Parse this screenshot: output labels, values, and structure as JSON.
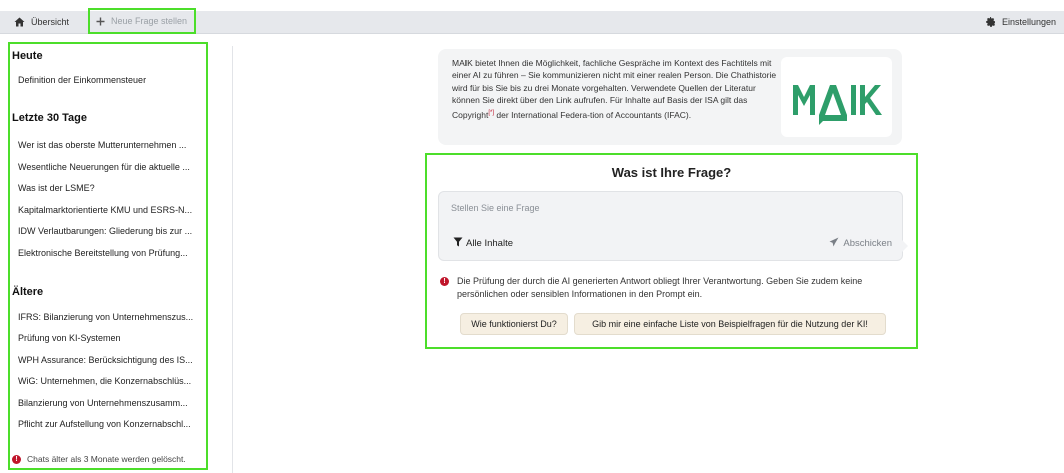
{
  "topbar": {
    "overview_label": "Übersicht",
    "overview_icon": "home-icon",
    "new_question_label": "Neue Frage stellen",
    "new_question_icon": "plus-icon",
    "settings_label": "Einstellungen",
    "settings_icon": "gear-icon"
  },
  "sidebar": {
    "sections": [
      {
        "heading": "Heute",
        "items": [
          "Definition der Einkommensteuer"
        ]
      },
      {
        "heading": "Letzte 30 Tage",
        "items": [
          "Wer ist das oberste Mutterunternehmen ...",
          "Wesentliche Neuerungen für die aktuelle ...",
          "Was ist der LSME?",
          "Kapitalmarktorientierte KMU und ESRS-N...",
          "IDW Verlautbarungen: Gliederung bis zur ...",
          "Elektronische Bereitstellung von Prüfung..."
        ]
      },
      {
        "heading": "Ältere",
        "items": [
          "IFRS: Bilanzierung von Unternehmenszus...",
          "Prüfung von KI-Systemen",
          "WPH Assurance: Berücksichtigung des IS...",
          "WiG: Unternehmen, die Konzernabschlüs...",
          "Bilanzierung von Unternehmenszusamm...",
          "Pflicht zur Aufstellung von Konzernabschl..."
        ]
      }
    ],
    "retention_note": "Chats älter als 3 Monate werden gelöscht."
  },
  "info": {
    "brand_prefix": "MA",
    "brand_highlight": "I",
    "brand_suffix": "K",
    "text_part1": " bietet Ihnen die Möglichkeit, fachliche Gespräche im Kontext des Fachtitels mit einer AI zu führen – Sie kommunizieren nicht mit einer realen Person. Die Chathistorie wird für bis Sie bis zu drei Monate vorgehalten. Verwendete Quellen der Literatur können Sie direkt über den Link aufrufen. Für Inhalte auf Basis der ISA gilt das Copyright",
    "copyright_mark": "[*]",
    "text_part2": " der International Federa-tion of Accountants (IFAC).",
    "logo_text": "MAIK",
    "logo_color": "#2e9e6a"
  },
  "question": {
    "title": "Was ist Ihre Frage?",
    "input_placeholder": "Stellen Sie eine Frage",
    "input_value": "",
    "filter_label": "Alle Inhalte",
    "send_label": "Abschicken",
    "warning": "Die Prüfung der durch die AI generierten Antwort obliegt Ihrer Verantwortung. Geben Sie zudem keine persönlichen oder sensiblen Informationen in den Prompt ein.",
    "suggestions": [
      "Wie funktionierst Du?",
      "Gib mir eine einfache Liste von Beispielfragen für die Nutzung der KI!"
    ]
  },
  "colors": {
    "highlight_outline": "#4cde2a",
    "warning_red": "#c0152b",
    "brand_green": "#2e9e6a",
    "chip_bg": "#f6efe2"
  }
}
